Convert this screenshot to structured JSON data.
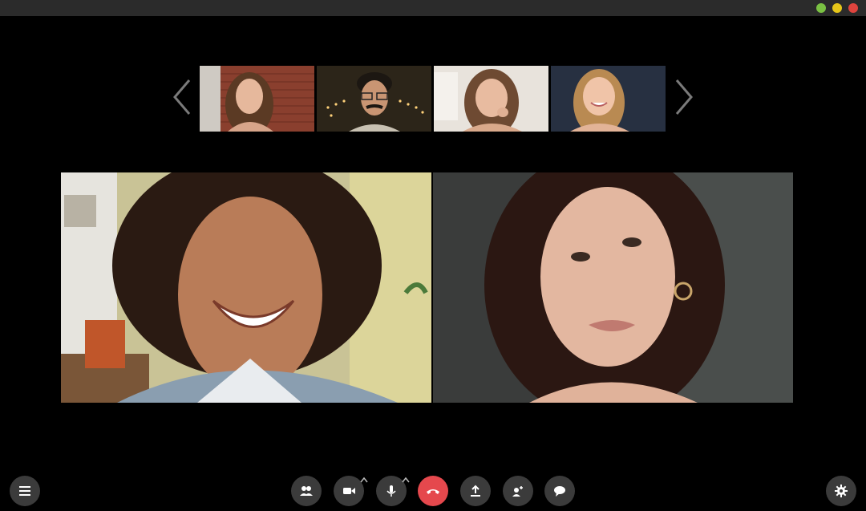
{
  "window": {
    "traffic_lights": [
      {
        "name": "green",
        "color": "#7ac143"
      },
      {
        "name": "yellow",
        "color": "#e6c619"
      },
      {
        "name": "red",
        "color": "#e0443e"
      }
    ]
  },
  "colors": {
    "background": "#000000",
    "control_bg": "#3b3b3b",
    "end_call": "#e5484d",
    "icon": "#ffffff"
  },
  "gallery": {
    "prev_icon": "chevron-left-icon",
    "next_icon": "chevron-right-icon",
    "thumbnails": [
      {
        "icon": "participant-video-thumbnail"
      },
      {
        "icon": "participant-video-thumbnail"
      },
      {
        "icon": "participant-video-thumbnail"
      },
      {
        "icon": "participant-video-thumbnail"
      }
    ]
  },
  "main_tiles": [
    {
      "icon": "participant-video"
    },
    {
      "icon": "participant-video"
    }
  ],
  "controls": {
    "menu": {
      "icon": "menu-icon"
    },
    "participants": {
      "icon": "participants-icon"
    },
    "camera": {
      "icon": "video-camera-icon"
    },
    "microphone": {
      "icon": "microphone-icon"
    },
    "end_call": {
      "icon": "phone-hangup-icon"
    },
    "share_screen": {
      "icon": "share-screen-icon"
    },
    "add_person": {
      "icon": "add-person-icon"
    },
    "chat": {
      "icon": "chat-icon"
    },
    "settings": {
      "icon": "gear-icon"
    }
  }
}
